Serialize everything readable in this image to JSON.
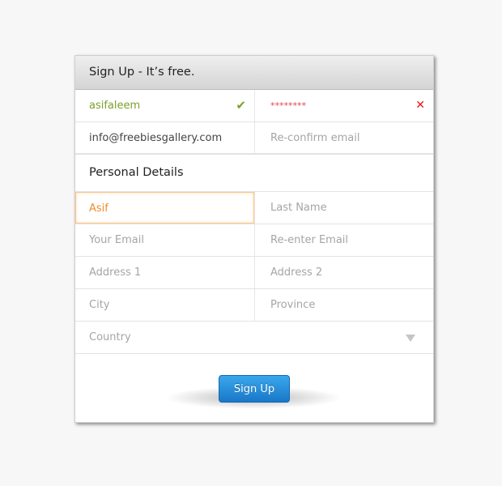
{
  "header": {
    "title": "Sign Up - It’s free."
  },
  "account": {
    "username": {
      "value": "asifaleem",
      "status_icon": "check-icon",
      "color": "#7aa02a"
    },
    "password": {
      "value": "********",
      "status_icon": "x-icon",
      "color": "#e0464a"
    },
    "email": {
      "value": "info@freebiesgallery.com"
    },
    "reconfirm_email": {
      "placeholder": "Re-confirm email"
    }
  },
  "personal": {
    "title": "Personal Details",
    "first_name": {
      "value": "Asif"
    },
    "last_name": {
      "placeholder": "Last Name"
    },
    "your_email": {
      "placeholder": "Your Email"
    },
    "reenter_email": {
      "placeholder": "Re-enter Email"
    },
    "address1": {
      "placeholder": "Address 1"
    },
    "address2": {
      "placeholder": "Address 2"
    },
    "city": {
      "placeholder": "City"
    },
    "province": {
      "placeholder": "Province"
    },
    "country": {
      "placeholder": "Country"
    }
  },
  "submit": {
    "label": "Sign Up",
    "color": "#2b8fdc"
  },
  "icons": {
    "check": "✔",
    "x": "✕"
  }
}
